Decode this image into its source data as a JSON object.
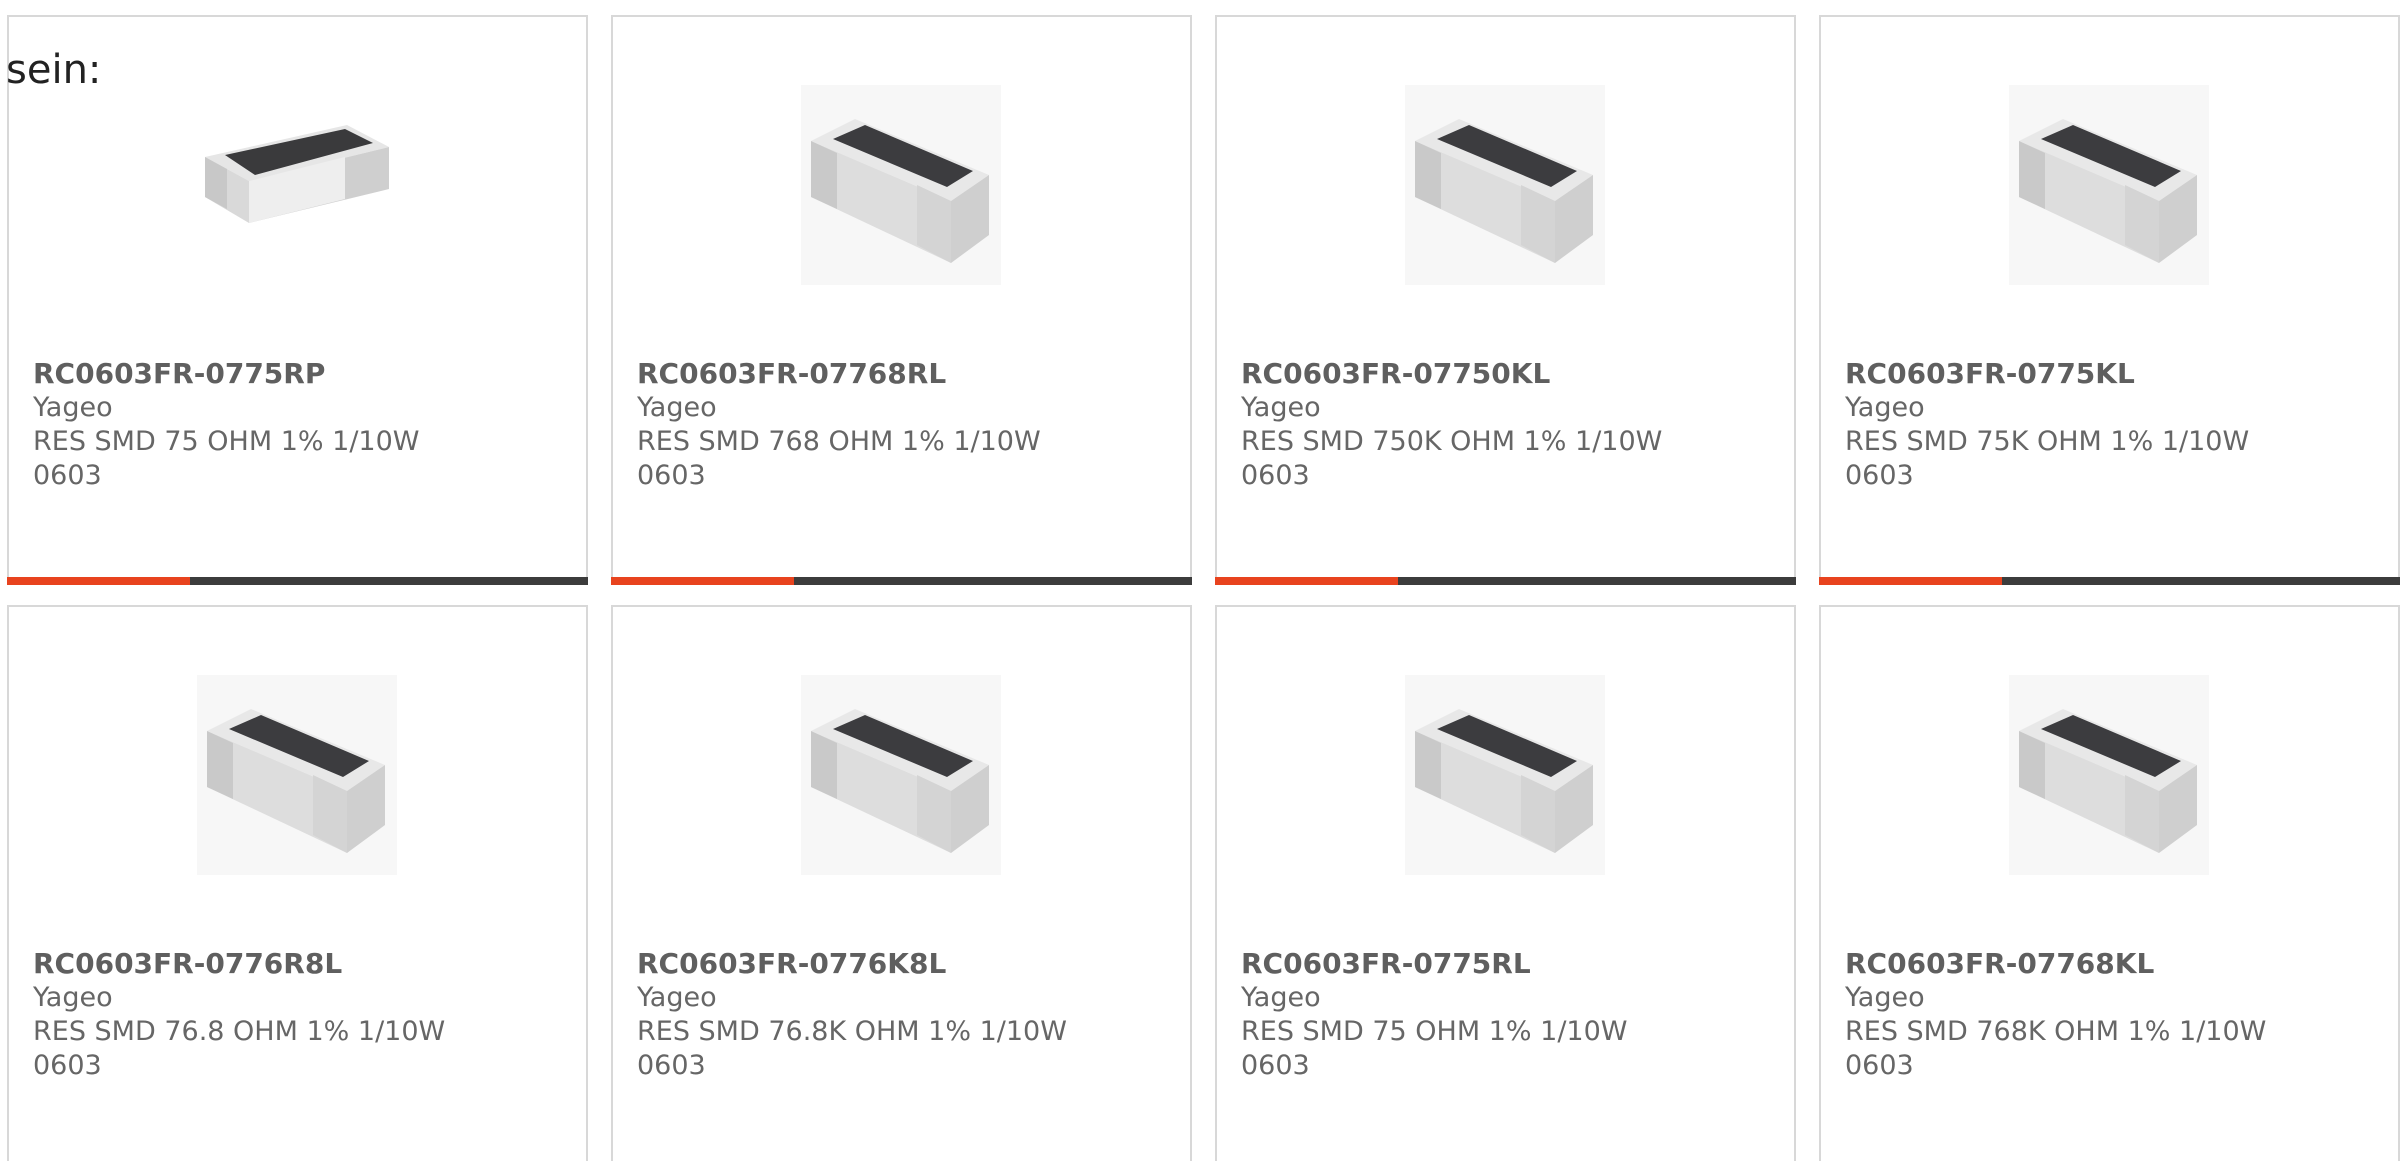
{
  "intro_text": "sein:",
  "colors": {
    "accent": "#e8431e",
    "bar": "#3c3c3c",
    "text": "#666666",
    "border": "#d8d8d8"
  },
  "products": [
    {
      "part": "RC0603FR-0775RP",
      "maker": "Yageo",
      "desc": "RES SMD 75 OHM 1% 1/10W",
      "pkg": "0603"
    },
    {
      "part": "RC0603FR-07768RL",
      "maker": "Yageo",
      "desc": "RES SMD 768 OHM 1% 1/10W",
      "pkg": "0603"
    },
    {
      "part": "RC0603FR-07750KL",
      "maker": "Yageo",
      "desc": "RES SMD 750K OHM 1% 1/10W",
      "pkg": "0603"
    },
    {
      "part": "RC0603FR-0775KL",
      "maker": "Yageo",
      "desc": "RES SMD 75K OHM 1% 1/10W",
      "pkg": "0603"
    },
    {
      "part": "RC0603FR-0776R8L",
      "maker": "Yageo",
      "desc": "RES SMD 76.8 OHM 1% 1/10W",
      "pkg": "0603"
    },
    {
      "part": "RC0603FR-0776K8L",
      "maker": "Yageo",
      "desc": "RES SMD 76.8K OHM 1% 1/10W",
      "pkg": "0603"
    },
    {
      "part": "RC0603FR-0775RL",
      "maker": "Yageo",
      "desc": "RES SMD 75 OHM 1% 1/10W",
      "pkg": "0603"
    },
    {
      "part": "RC0603FR-07768KL",
      "maker": "Yageo",
      "desc": "RES SMD 768K OHM 1% 1/10W",
      "pkg": "0603"
    }
  ]
}
